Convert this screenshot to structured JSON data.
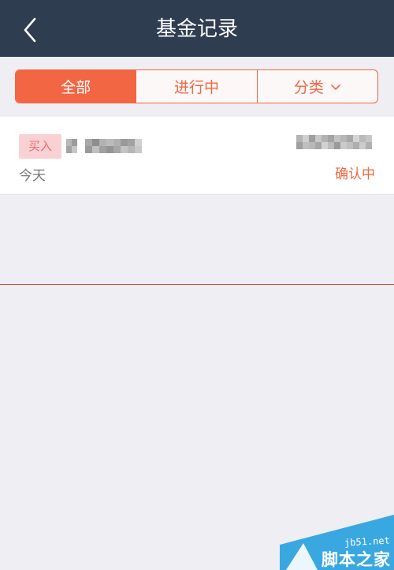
{
  "header": {
    "title": "基金记录",
    "back_icon": "chevron-left-icon"
  },
  "tabs": [
    {
      "label": "全部",
      "active": true
    },
    {
      "label": "进行中",
      "active": false
    },
    {
      "label": "分类",
      "active": false,
      "icon": "chevron-down-icon"
    }
  ],
  "records": [
    {
      "type": "买入",
      "fund_name": "",
      "amount": "",
      "date": "今天",
      "status": "确认中"
    }
  ],
  "watermark": {
    "domain": "jb51.net",
    "brand": "脚本之家"
  },
  "colors": {
    "header_bg": "#2e3d50",
    "accent": "#f26644",
    "page_bg": "#efeef3",
    "badge_bg": "#f9d1d4",
    "badge_text": "#ea6e72",
    "watermark_blue": "#3aa8e0"
  }
}
